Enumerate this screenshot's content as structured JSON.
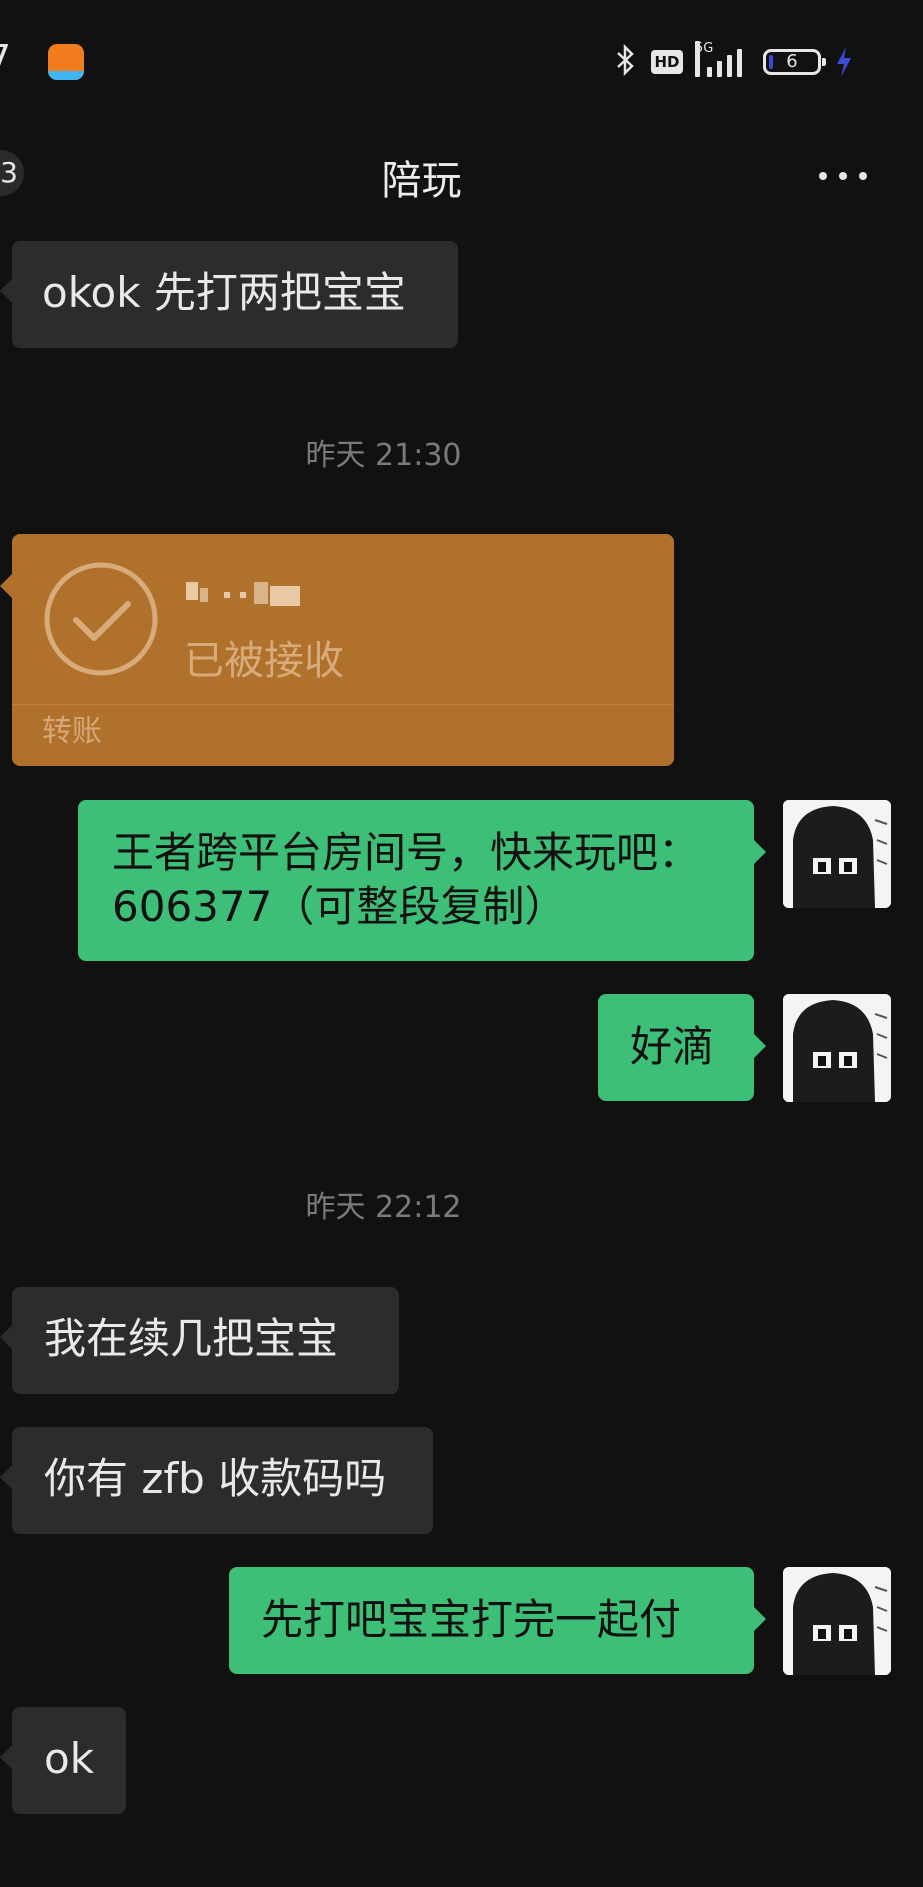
{
  "status_bar": {
    "time": "7",
    "network": "5G",
    "hd": "HD",
    "battery": "6",
    "colors": {
      "charging": "#3a4bd8",
      "app_icon": "#f07c1e"
    }
  },
  "nav": {
    "back_count": "3",
    "title": "陪玩"
  },
  "messages": {
    "m1": "okok 先打两把宝宝",
    "ts1": "昨天 21:30",
    "transfer": {
      "status": "已被接收",
      "label": "转账"
    },
    "m2_line1": "王者跨平台房间号，快来玩吧：",
    "m2_line2": "606377（可整段复制）",
    "m3": "好滴",
    "ts2": "昨天 22:12",
    "m4": "我在续几把宝宝",
    "m5": "你有 zfb 收款码吗",
    "m6": "先打吧宝宝打完一起付",
    "m7": "ok"
  },
  "colors": {
    "background": "#111111",
    "incoming_bubble": "#2c2c2c",
    "outgoing_bubble": "#3dbf78",
    "transfer_card": "#b0712c"
  }
}
